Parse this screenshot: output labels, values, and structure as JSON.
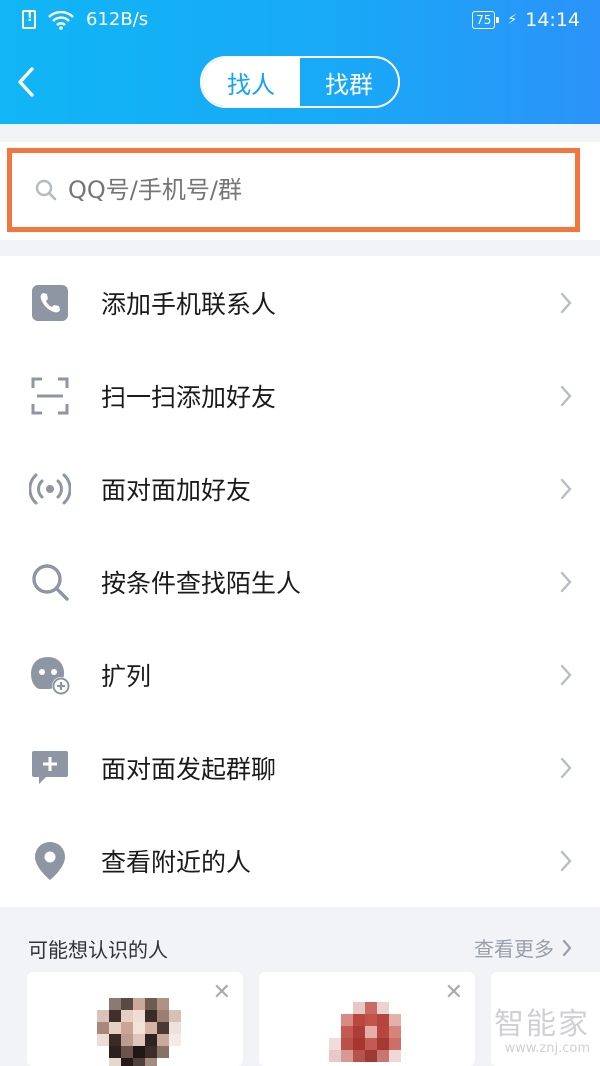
{
  "status_bar": {
    "network_speed": "612B/s",
    "battery_level": "75",
    "time": "14:14"
  },
  "header": {
    "tabs": [
      {
        "label": "找人",
        "active": true
      },
      {
        "label": "找群",
        "active": false
      }
    ]
  },
  "search": {
    "placeholder": "QQ号/手机号/群"
  },
  "menu": [
    {
      "label": "添加手机联系人",
      "icon": "phone-icon"
    },
    {
      "label": "扫一扫添加好友",
      "icon": "scan-icon"
    },
    {
      "label": "面对面加好友",
      "icon": "radar-icon"
    },
    {
      "label": "按条件查找陌生人",
      "icon": "search-icon"
    },
    {
      "label": "扩列",
      "icon": "face-add-icon"
    },
    {
      "label": "面对面发起群聊",
      "icon": "chat-add-icon"
    },
    {
      "label": "查看附近的人",
      "icon": "location-icon"
    }
  ],
  "people": {
    "title": "可能想认识的人",
    "more_label": "查看更多"
  },
  "watermark": {
    "text": "智能家",
    "url": "www.znj.com"
  },
  "colors": {
    "header_start": "#10b6f5",
    "header_end": "#2b93f9",
    "highlight_border": "#f2763d",
    "icon_gray": "#8e95a3"
  }
}
